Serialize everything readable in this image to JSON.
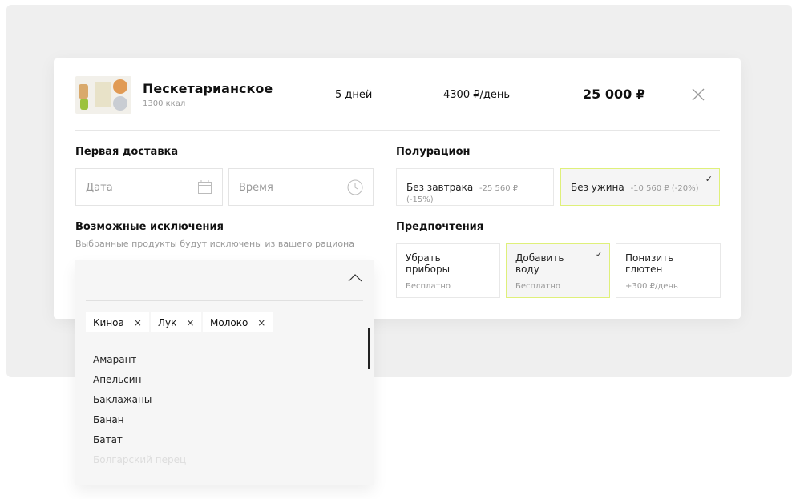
{
  "product": {
    "title": "Пескетарианское",
    "kcal": "1300 ккал",
    "days": "5 дней",
    "per_day": "4300 ₽/день",
    "total": "25 000 ₽"
  },
  "delivery": {
    "heading": "Первая доставка",
    "date_placeholder": "Дата",
    "time_placeholder": "Время"
  },
  "half": {
    "heading": "Полурацион",
    "options": [
      {
        "label": "Без завтрака",
        "note": "-25 560 ₽ (-15%)",
        "selected": false
      },
      {
        "label": "Без ужина",
        "note": "-10 560 ₽ (-20%)",
        "selected": true
      }
    ]
  },
  "exclusions": {
    "heading": "Возможные исключения",
    "subtitle": "Выбранные продукты будут исключены из вашего рациона",
    "chips": [
      "Киноа",
      "Лук",
      "Молоко"
    ],
    "items": [
      "Амарант",
      "Апельсин",
      "Баклажаны",
      "Банан",
      "Батат",
      "Болгарский перец"
    ]
  },
  "prefs": {
    "heading": "Предпочтения",
    "options": [
      {
        "label1": "Убрать",
        "label2": "приборы",
        "price": "Бесплатно",
        "selected": false
      },
      {
        "label1": "Добавить",
        "label2": "воду",
        "price": "Бесплатно",
        "selected": true
      },
      {
        "label1": "Понизить",
        "label2": "глютен",
        "price": "+300 ₽/день",
        "selected": false
      }
    ]
  },
  "colors": {
    "selected_border": "#dff07a",
    "selected_bg": "#f5f5f5"
  }
}
